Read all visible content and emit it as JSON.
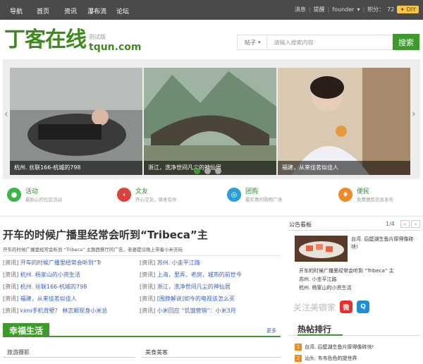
{
  "topbar": {
    "nav": [
      "导航",
      "首页",
      "资讯",
      "瀑布流",
      "论坛"
    ],
    "messages": "消息",
    "remind": "提醒",
    "user": "founder",
    "points_label": "积分：",
    "points": "72",
    "diy": "DIY"
  },
  "logo": {
    "cn": "丁客在线",
    "test": "测试版",
    "domain": "tqun.com"
  },
  "search": {
    "select": "帖子",
    "placeholder": "请输入搜索内容",
    "button": "搜索"
  },
  "slider": {
    "captions": [
      "杭州. 丝联166-杭城的798",
      "浙江，洗净世间凡尘的神仙居",
      "福建，从来佳茗似佳人"
    ]
  },
  "features": [
    {
      "title": "活动",
      "desc": "最贴心的社区活动",
      "color": "#3bb44a",
      "icon": "activity-icon"
    },
    {
      "title": "文友",
      "desc": "开心交友，缘来有你",
      "color": "#d9433f",
      "icon": "friends-icon"
    },
    {
      "title": "团购",
      "desc": "最实惠的购物广场",
      "color": "#2a9fd6",
      "icon": "group-buy-icon"
    },
    {
      "title": "便民",
      "desc": "免费便民信息发布",
      "color": "#ef8a2b",
      "icon": "service-icon"
    }
  ],
  "headline": {
    "title": "开车的时候广播里经常会听到“Tribeca”主",
    "desc": "开车的时候广播里经常会听到 “Tribeca” 主题西餐厅的广告，老婆提议晚上带着小米去玩"
  },
  "news_left": [
    {
      "cat": "[资讯]",
      "title": "开车的时候广播里经常会听到“Tr"
    },
    {
      "cat": "[资讯]",
      "title": "杭州. 杨家山的小资生活"
    },
    {
      "cat": "[资讯]",
      "title": "杭州. 丝联166-杭城的798"
    },
    {
      "cat": "[资讯]",
      "title": "福建，从来佳茗似佳人"
    },
    {
      "cat": "[资讯]",
      "title": "kimi手机背壁？ 林志颖现身小米总"
    }
  ],
  "news_right": [
    {
      "cat": "[资讯]",
      "title": "苏州. 小圭平江路"
    },
    {
      "cat": "[资讯]",
      "title": "上海，里弄、老房，城市的前世今"
    },
    {
      "cat": "[资讯]",
      "title": "浙江，洗净世间凡尘的神仙居"
    },
    {
      "cat": "[资讯]",
      "title": "[围脖解说]如今的电视该怎么买"
    },
    {
      "cat": "[资讯]",
      "title": "小米回应 “饥饿营销”：小米3月"
    }
  ],
  "life": {
    "title": "幸福生活",
    "more": "更多",
    "sub1": "旅游摄影",
    "sub2": "美食美客"
  },
  "notice": {
    "title": "公告看板",
    "page": "1/4",
    "image_text": "台湾. 后壁湖生鱼片厚得像砖块!",
    "items": [
      "开车的时候广播里经常会听到 “Tribeca” 主",
      "苏州. 小圭平江路",
      "杭州. 杨家山的小资生活"
    ]
  },
  "follow": {
    "label": "关注美宿家"
  },
  "hot": {
    "title": "热帖排行",
    "items": [
      {
        "n": "1",
        "title": "台湾. 后壁湖生鱼片厚得像砖块!"
      },
      {
        "n": "2",
        "title": "汕头. 韦韦色色的提世界"
      }
    ]
  }
}
